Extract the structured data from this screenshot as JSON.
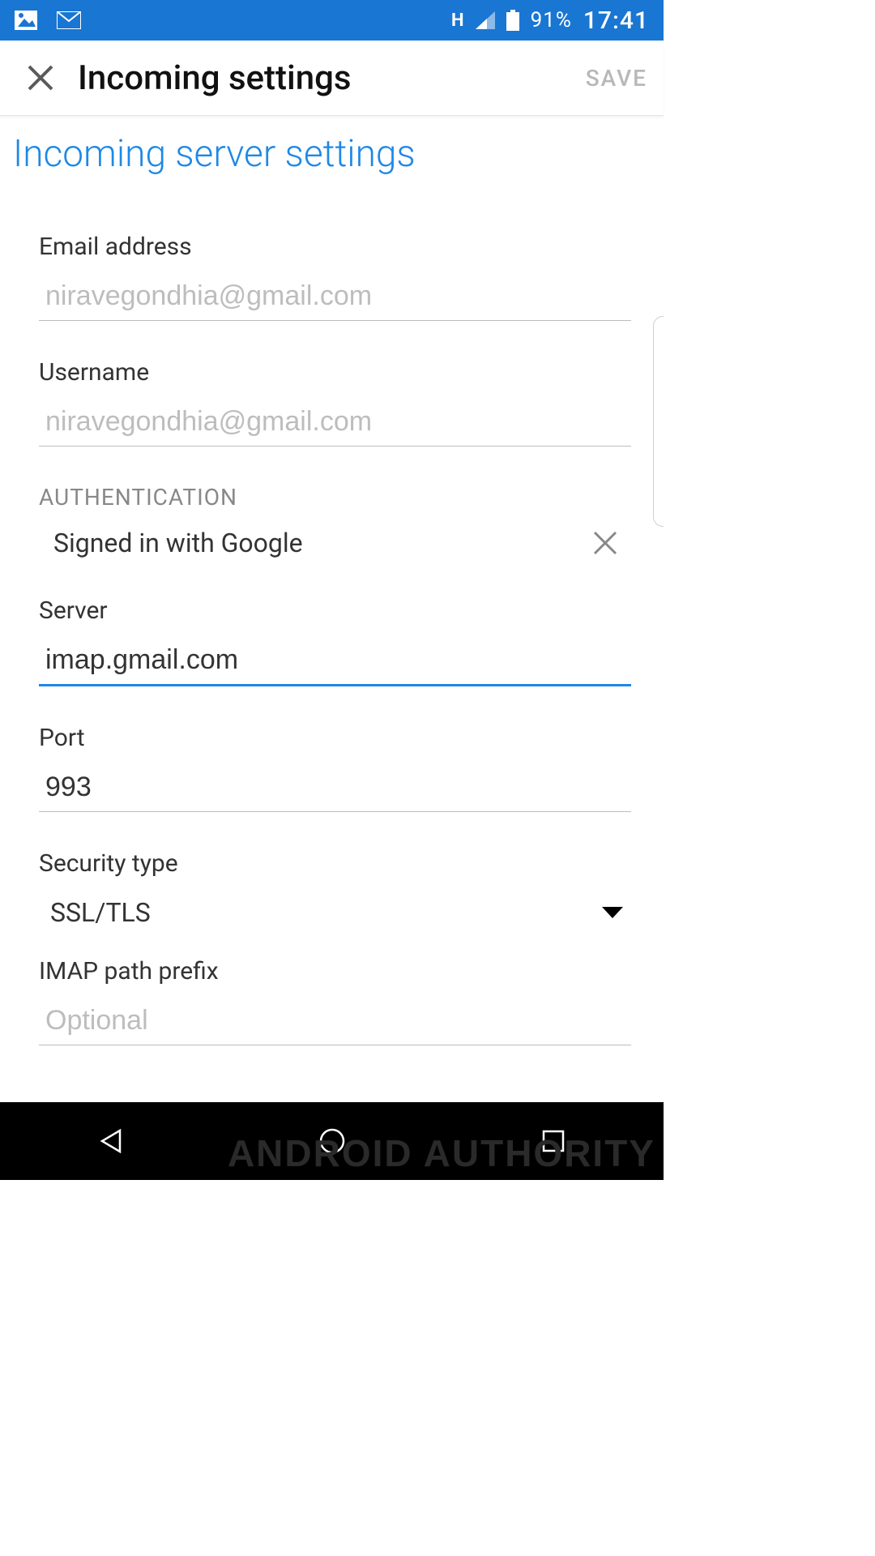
{
  "status": {
    "network_type": "H",
    "battery_pct": "91%",
    "clock": "17:41"
  },
  "appbar": {
    "title": "Incoming settings",
    "save_label": "SAVE"
  },
  "section": {
    "heading": "Incoming server settings"
  },
  "fields": {
    "email_label": "Email address",
    "email_value": "niravegondhia@gmail.com",
    "username_label": "Username",
    "username_value": "niravegondhia@gmail.com",
    "auth_label": "AUTHENTICATION",
    "auth_value": "Signed in with Google",
    "server_label": "Server",
    "server_value": "imap.gmail.com",
    "port_label": "Port",
    "port_value": "993",
    "security_label": "Security type",
    "security_value": "SSL/TLS",
    "prefix_label": "IMAP path prefix",
    "prefix_placeholder": "Optional"
  },
  "watermark": "ANDROID AUTHORITY",
  "colors": {
    "accent": "#1e88e5",
    "status_bar": "#1976d2"
  }
}
